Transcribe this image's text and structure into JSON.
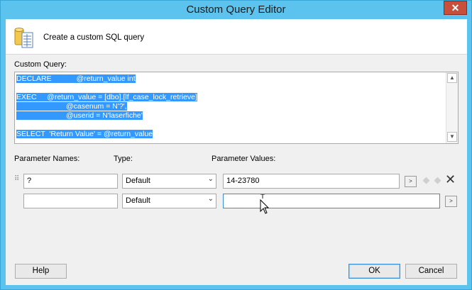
{
  "window": {
    "title": "Custom Query Editor",
    "close_glyph": "✕"
  },
  "header": {
    "icon": "database-document-icon",
    "text": "Create a custom SQL query"
  },
  "query": {
    "label": "Custom Query:",
    "lines": [
      "DECLARE            @return_value int",
      "",
      "EXEC     @return_value = [dbo].[lf_case_lock_retrieve]",
      "                        @casenum = N'?',",
      "                        @userid = N'laserfiche'",
      "",
      "SELECT  'Return Value' = @return_value"
    ]
  },
  "params": {
    "names_header": "Parameter Names:",
    "type_header": "Type:",
    "values_header": "Parameter Values:",
    "rows": [
      {
        "name": "?",
        "type": "Default",
        "value": "14-23780"
      },
      {
        "name": "",
        "type": "Default",
        "value": ""
      }
    ],
    "expand_glyph": ">",
    "move_up_icon": "arrow-up-icon",
    "move_down_icon": "arrow-down-icon",
    "delete_icon": "delete-x-icon"
  },
  "buttons": {
    "help": "Help",
    "ok": "OK",
    "cancel": "Cancel"
  },
  "colors": {
    "titlebar": "#5cc2ee",
    "selection": "#3399ff",
    "close": "#c7503c"
  }
}
